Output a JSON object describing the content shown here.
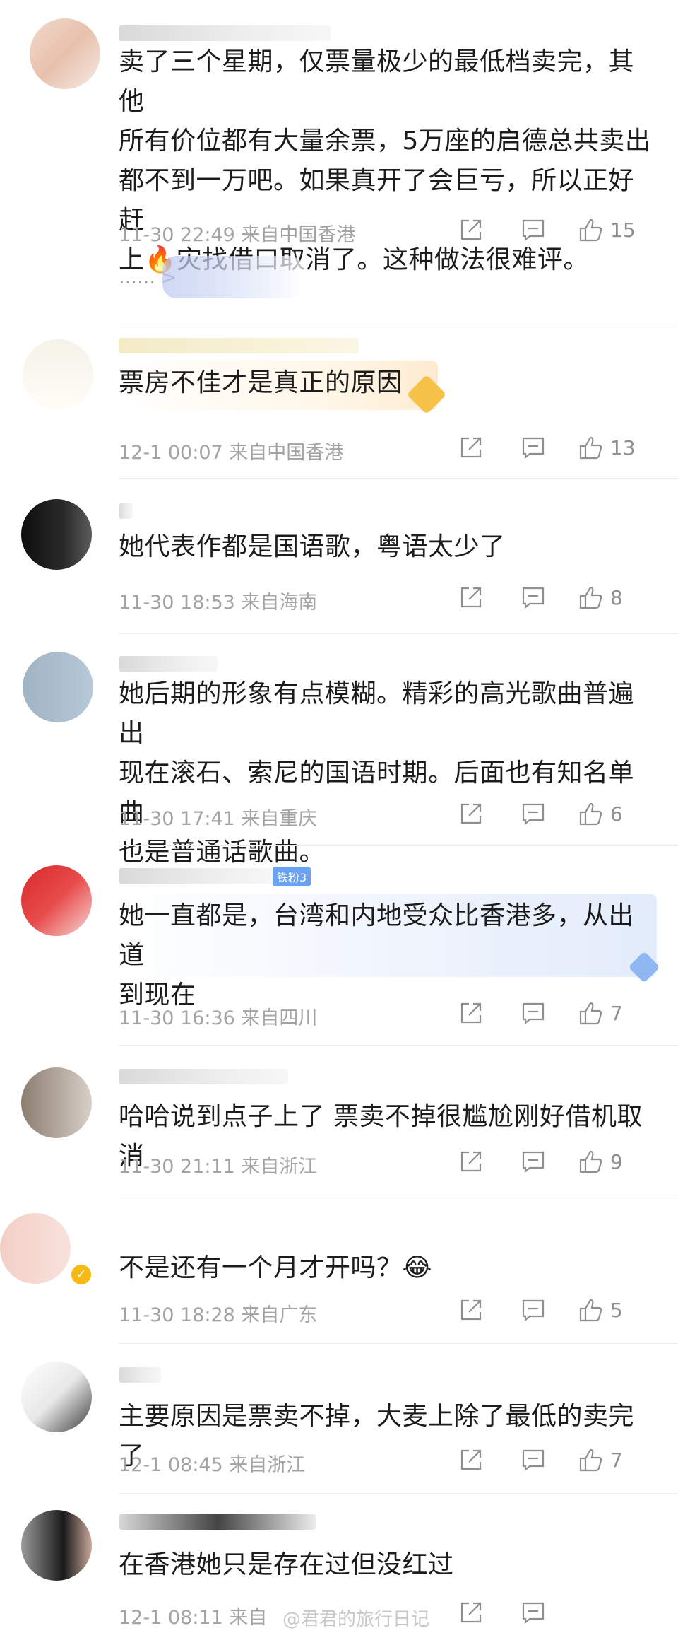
{
  "comments": [
    {
      "text_lines": [
        "卖了三个星期，仅票量极少的最低档卖完，其他",
        "所有价位都有大量余票，5万座的启德总共卖出",
        "都不到一万吧。如果真开了会巨亏，所以正好赶",
        "上🔥灾找借口取消了。这种做法很难评。"
      ],
      "time": "11-30 22:49 来自中国香港",
      "likes": "15",
      "replies_more": "…… >"
    },
    {
      "text": "票房不佳才是真正的原因",
      "time": "12-1 00:07 来自中国香港",
      "likes": "13"
    },
    {
      "text": "她代表作都是国语歌，粤语太少了",
      "time": "11-30 18:53 来自海南",
      "likes": "8"
    },
    {
      "text_lines": [
        "她后期的形象有点模糊。精彩的高光歌曲普遍出",
        "现在滚石、索尼的国语时期。后面也有知名单曲",
        "也是普通话歌曲。"
      ],
      "time": "11-30 17:41 来自重庆",
      "likes": "6"
    },
    {
      "badge": "铁粉3",
      "text_lines": [
        "她一直都是，台湾和内地受众比香港多，从出道",
        "到现在"
      ],
      "time": "11-30 16:36 来自四川",
      "likes": "7"
    },
    {
      "text": "哈哈说到点子上了 票卖不掉很尴尬刚好借机取消",
      "time": "11-30 21:11 来自浙江",
      "likes": "9"
    },
    {
      "text": "不是还有一个月才开吗？😂",
      "time": "11-30 18:28 来自广东",
      "likes": "5"
    },
    {
      "text": "主要原因是票卖不掉，大麦上除了最低的卖完了",
      "time": "12-1 08:45 来自浙江",
      "likes": "7"
    },
    {
      "text": "在香港她只是存在过但没红过",
      "time": "12-1 08:11 来自",
      "likes": ""
    }
  ],
  "icons": {
    "share": "share-icon",
    "comment": "comment-icon",
    "like": "thumbs-up-icon"
  },
  "watermark": "@君君的旅行日记",
  "colors": {
    "text": "#1c1c1c",
    "meta": "#a3a3a3",
    "icon": "#8f8f8f",
    "badge": "#6aa2f0"
  }
}
